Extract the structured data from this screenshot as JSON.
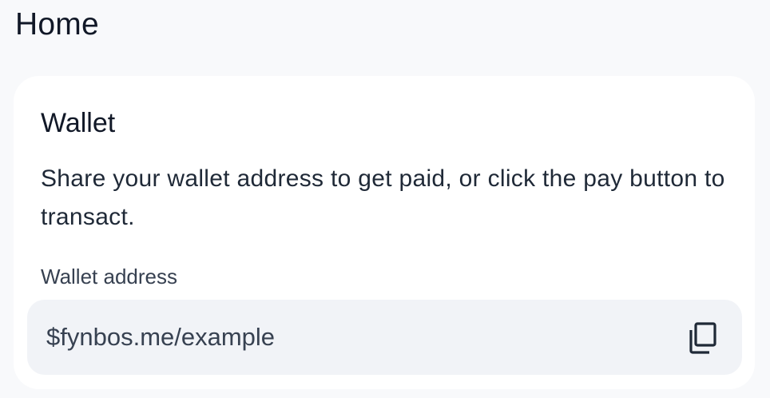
{
  "header": {
    "title": "Home"
  },
  "wallet_card": {
    "title": "Wallet",
    "description": "Share your wallet address to get paid, or click the pay button to transact.",
    "address_field": {
      "label": "Wallet address",
      "value": "$fynbos.me/example",
      "copy_icon": "copy-icon"
    }
  },
  "colors": {
    "page_background": "#f8f9fb",
    "card_background": "#ffffff",
    "field_background": "#f1f3f7",
    "text_primary": "#111827",
    "text_secondary": "#374151"
  }
}
